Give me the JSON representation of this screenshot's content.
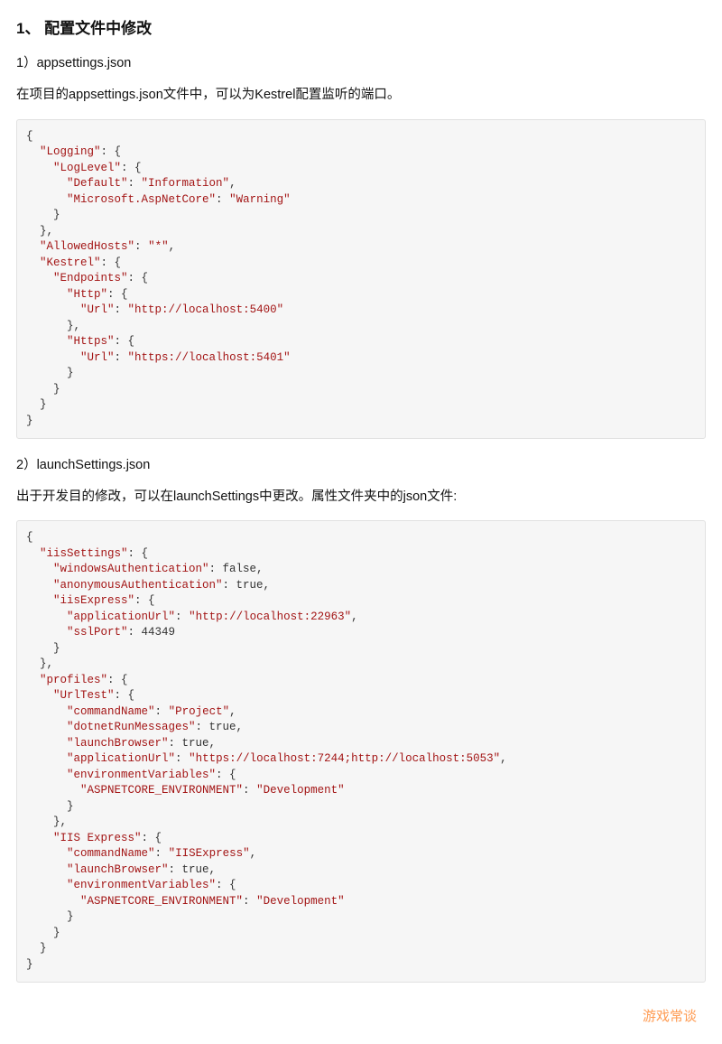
{
  "section": {
    "title": "1、 配置文件中修改",
    "sub1": {
      "label": "1）appsettings.json",
      "desc": "在项目的appsettings.json文件中，可以为Kestrel配置监听的端口。",
      "code": {
        "tokens": [
          {
            "t": "{",
            "c": "v",
            "nl": 1
          },
          {
            "t": "  ",
            "c": "v"
          },
          {
            "t": "\"Logging\"",
            "c": "k"
          },
          {
            "t": ": {",
            "c": "v",
            "nl": 1
          },
          {
            "t": "    ",
            "c": "v"
          },
          {
            "t": "\"LogLevel\"",
            "c": "k"
          },
          {
            "t": ": {",
            "c": "v",
            "nl": 1
          },
          {
            "t": "      ",
            "c": "v"
          },
          {
            "t": "\"Default\"",
            "c": "k"
          },
          {
            "t": ": ",
            "c": "v"
          },
          {
            "t": "\"Information\"",
            "c": "k"
          },
          {
            "t": ",",
            "c": "v",
            "nl": 1
          },
          {
            "t": "      ",
            "c": "v"
          },
          {
            "t": "\"Microsoft.AspNetCore\"",
            "c": "k"
          },
          {
            "t": ": ",
            "c": "v"
          },
          {
            "t": "\"Warning\"",
            "c": "k",
            "nl": 1
          },
          {
            "t": "    }",
            "c": "v",
            "nl": 1
          },
          {
            "t": "  },",
            "c": "v",
            "nl": 1
          },
          {
            "t": "  ",
            "c": "v"
          },
          {
            "t": "\"AllowedHosts\"",
            "c": "k"
          },
          {
            "t": ": ",
            "c": "v"
          },
          {
            "t": "\"*\"",
            "c": "k"
          },
          {
            "t": ",",
            "c": "v",
            "nl": 1
          },
          {
            "t": "  ",
            "c": "v"
          },
          {
            "t": "\"Kestrel\"",
            "c": "k"
          },
          {
            "t": ": {",
            "c": "v",
            "nl": 1
          },
          {
            "t": "    ",
            "c": "v"
          },
          {
            "t": "\"Endpoints\"",
            "c": "k"
          },
          {
            "t": ": {",
            "c": "v",
            "nl": 1
          },
          {
            "t": "      ",
            "c": "v"
          },
          {
            "t": "\"Http\"",
            "c": "k"
          },
          {
            "t": ": {",
            "c": "v",
            "nl": 1
          },
          {
            "t": "        ",
            "c": "v"
          },
          {
            "t": "\"Url\"",
            "c": "k"
          },
          {
            "t": ": ",
            "c": "v"
          },
          {
            "t": "\"http://localhost:5400\"",
            "c": "k",
            "nl": 1
          },
          {
            "t": "      },",
            "c": "v",
            "nl": 1
          },
          {
            "t": "      ",
            "c": "v"
          },
          {
            "t": "\"Https\"",
            "c": "k"
          },
          {
            "t": ": {",
            "c": "v",
            "nl": 1
          },
          {
            "t": "        ",
            "c": "v"
          },
          {
            "t": "\"Url\"",
            "c": "k"
          },
          {
            "t": ": ",
            "c": "v"
          },
          {
            "t": "\"https://localhost:5401\"",
            "c": "k",
            "nl": 1
          },
          {
            "t": "      }",
            "c": "v",
            "nl": 1
          },
          {
            "t": "    }",
            "c": "v",
            "nl": 1
          },
          {
            "t": "  }",
            "c": "v",
            "nl": 1
          },
          {
            "t": "}",
            "c": "v"
          }
        ]
      }
    },
    "sub2": {
      "label": "2）launchSettings.json",
      "desc": "出于开发目的修改，可以在launchSettings中更改。属性文件夹中的json文件:",
      "code": {
        "tokens": [
          {
            "t": "{",
            "c": "v",
            "nl": 1
          },
          {
            "t": "  ",
            "c": "v"
          },
          {
            "t": "\"iisSettings\"",
            "c": "k"
          },
          {
            "t": ": {",
            "c": "v",
            "nl": 1
          },
          {
            "t": "    ",
            "c": "v"
          },
          {
            "t": "\"windowsAuthentication\"",
            "c": "k"
          },
          {
            "t": ": false,",
            "c": "v",
            "nl": 1
          },
          {
            "t": "    ",
            "c": "v"
          },
          {
            "t": "\"anonymousAuthentication\"",
            "c": "k"
          },
          {
            "t": ": true,",
            "c": "v",
            "nl": 1
          },
          {
            "t": "    ",
            "c": "v"
          },
          {
            "t": "\"iisExpress\"",
            "c": "k"
          },
          {
            "t": ": {",
            "c": "v",
            "nl": 1
          },
          {
            "t": "      ",
            "c": "v"
          },
          {
            "t": "\"applicationUrl\"",
            "c": "k"
          },
          {
            "t": ": ",
            "c": "v"
          },
          {
            "t": "\"http://localhost:22963\"",
            "c": "k"
          },
          {
            "t": ",",
            "c": "v",
            "nl": 1
          },
          {
            "t": "      ",
            "c": "v"
          },
          {
            "t": "\"sslPort\"",
            "c": "k"
          },
          {
            "t": ": 44349",
            "c": "v",
            "nl": 1
          },
          {
            "t": "    }",
            "c": "v",
            "nl": 1
          },
          {
            "t": "  },",
            "c": "v",
            "nl": 1
          },
          {
            "t": "  ",
            "c": "v"
          },
          {
            "t": "\"profiles\"",
            "c": "k"
          },
          {
            "t": ": {",
            "c": "v",
            "nl": 1
          },
          {
            "t": "    ",
            "c": "v"
          },
          {
            "t": "\"UrlTest\"",
            "c": "k"
          },
          {
            "t": ": {",
            "c": "v",
            "nl": 1
          },
          {
            "t": "      ",
            "c": "v"
          },
          {
            "t": "\"commandName\"",
            "c": "k"
          },
          {
            "t": ": ",
            "c": "v"
          },
          {
            "t": "\"Project\"",
            "c": "k"
          },
          {
            "t": ",",
            "c": "v",
            "nl": 1
          },
          {
            "t": "      ",
            "c": "v"
          },
          {
            "t": "\"dotnetRunMessages\"",
            "c": "k"
          },
          {
            "t": ": true,",
            "c": "v",
            "nl": 1
          },
          {
            "t": "      ",
            "c": "v"
          },
          {
            "t": "\"launchBrowser\"",
            "c": "k"
          },
          {
            "t": ": true,",
            "c": "v",
            "nl": 1
          },
          {
            "t": "      ",
            "c": "v"
          },
          {
            "t": "\"applicationUrl\"",
            "c": "k"
          },
          {
            "t": ": ",
            "c": "v"
          },
          {
            "t": "\"https://localhost:7244;http://localhost:5053\"",
            "c": "k"
          },
          {
            "t": ",",
            "c": "v",
            "nl": 1
          },
          {
            "t": "      ",
            "c": "v"
          },
          {
            "t": "\"environmentVariables\"",
            "c": "k"
          },
          {
            "t": ": {",
            "c": "v",
            "nl": 1
          },
          {
            "t": "        ",
            "c": "v"
          },
          {
            "t": "\"ASPNETCORE_ENVIRONMENT\"",
            "c": "k"
          },
          {
            "t": ": ",
            "c": "v"
          },
          {
            "t": "\"Development\"",
            "c": "k",
            "nl": 1
          },
          {
            "t": "      }",
            "c": "v",
            "nl": 1
          },
          {
            "t": "    },",
            "c": "v",
            "nl": 1
          },
          {
            "t": "    ",
            "c": "v"
          },
          {
            "t": "\"IIS Express\"",
            "c": "k"
          },
          {
            "t": ": {",
            "c": "v",
            "nl": 1
          },
          {
            "t": "      ",
            "c": "v"
          },
          {
            "t": "\"commandName\"",
            "c": "k"
          },
          {
            "t": ": ",
            "c": "v"
          },
          {
            "t": "\"IISExpress\"",
            "c": "k"
          },
          {
            "t": ",",
            "c": "v",
            "nl": 1
          },
          {
            "t": "      ",
            "c": "v"
          },
          {
            "t": "\"launchBrowser\"",
            "c": "k"
          },
          {
            "t": ": true,",
            "c": "v",
            "nl": 1
          },
          {
            "t": "      ",
            "c": "v"
          },
          {
            "t": "\"environmentVariables\"",
            "c": "k"
          },
          {
            "t": ": {",
            "c": "v",
            "nl": 1
          },
          {
            "t": "        ",
            "c": "v"
          },
          {
            "t": "\"ASPNETCORE_ENVIRONMENT\"",
            "c": "k"
          },
          {
            "t": ": ",
            "c": "v"
          },
          {
            "t": "\"Development\"",
            "c": "k",
            "nl": 1
          },
          {
            "t": "      }",
            "c": "v",
            "nl": 1
          },
          {
            "t": "    }",
            "c": "v",
            "nl": 1
          },
          {
            "t": "  }",
            "c": "v",
            "nl": 1
          },
          {
            "t": "}",
            "c": "v"
          }
        ]
      }
    }
  },
  "watermark": "游戏常谈"
}
